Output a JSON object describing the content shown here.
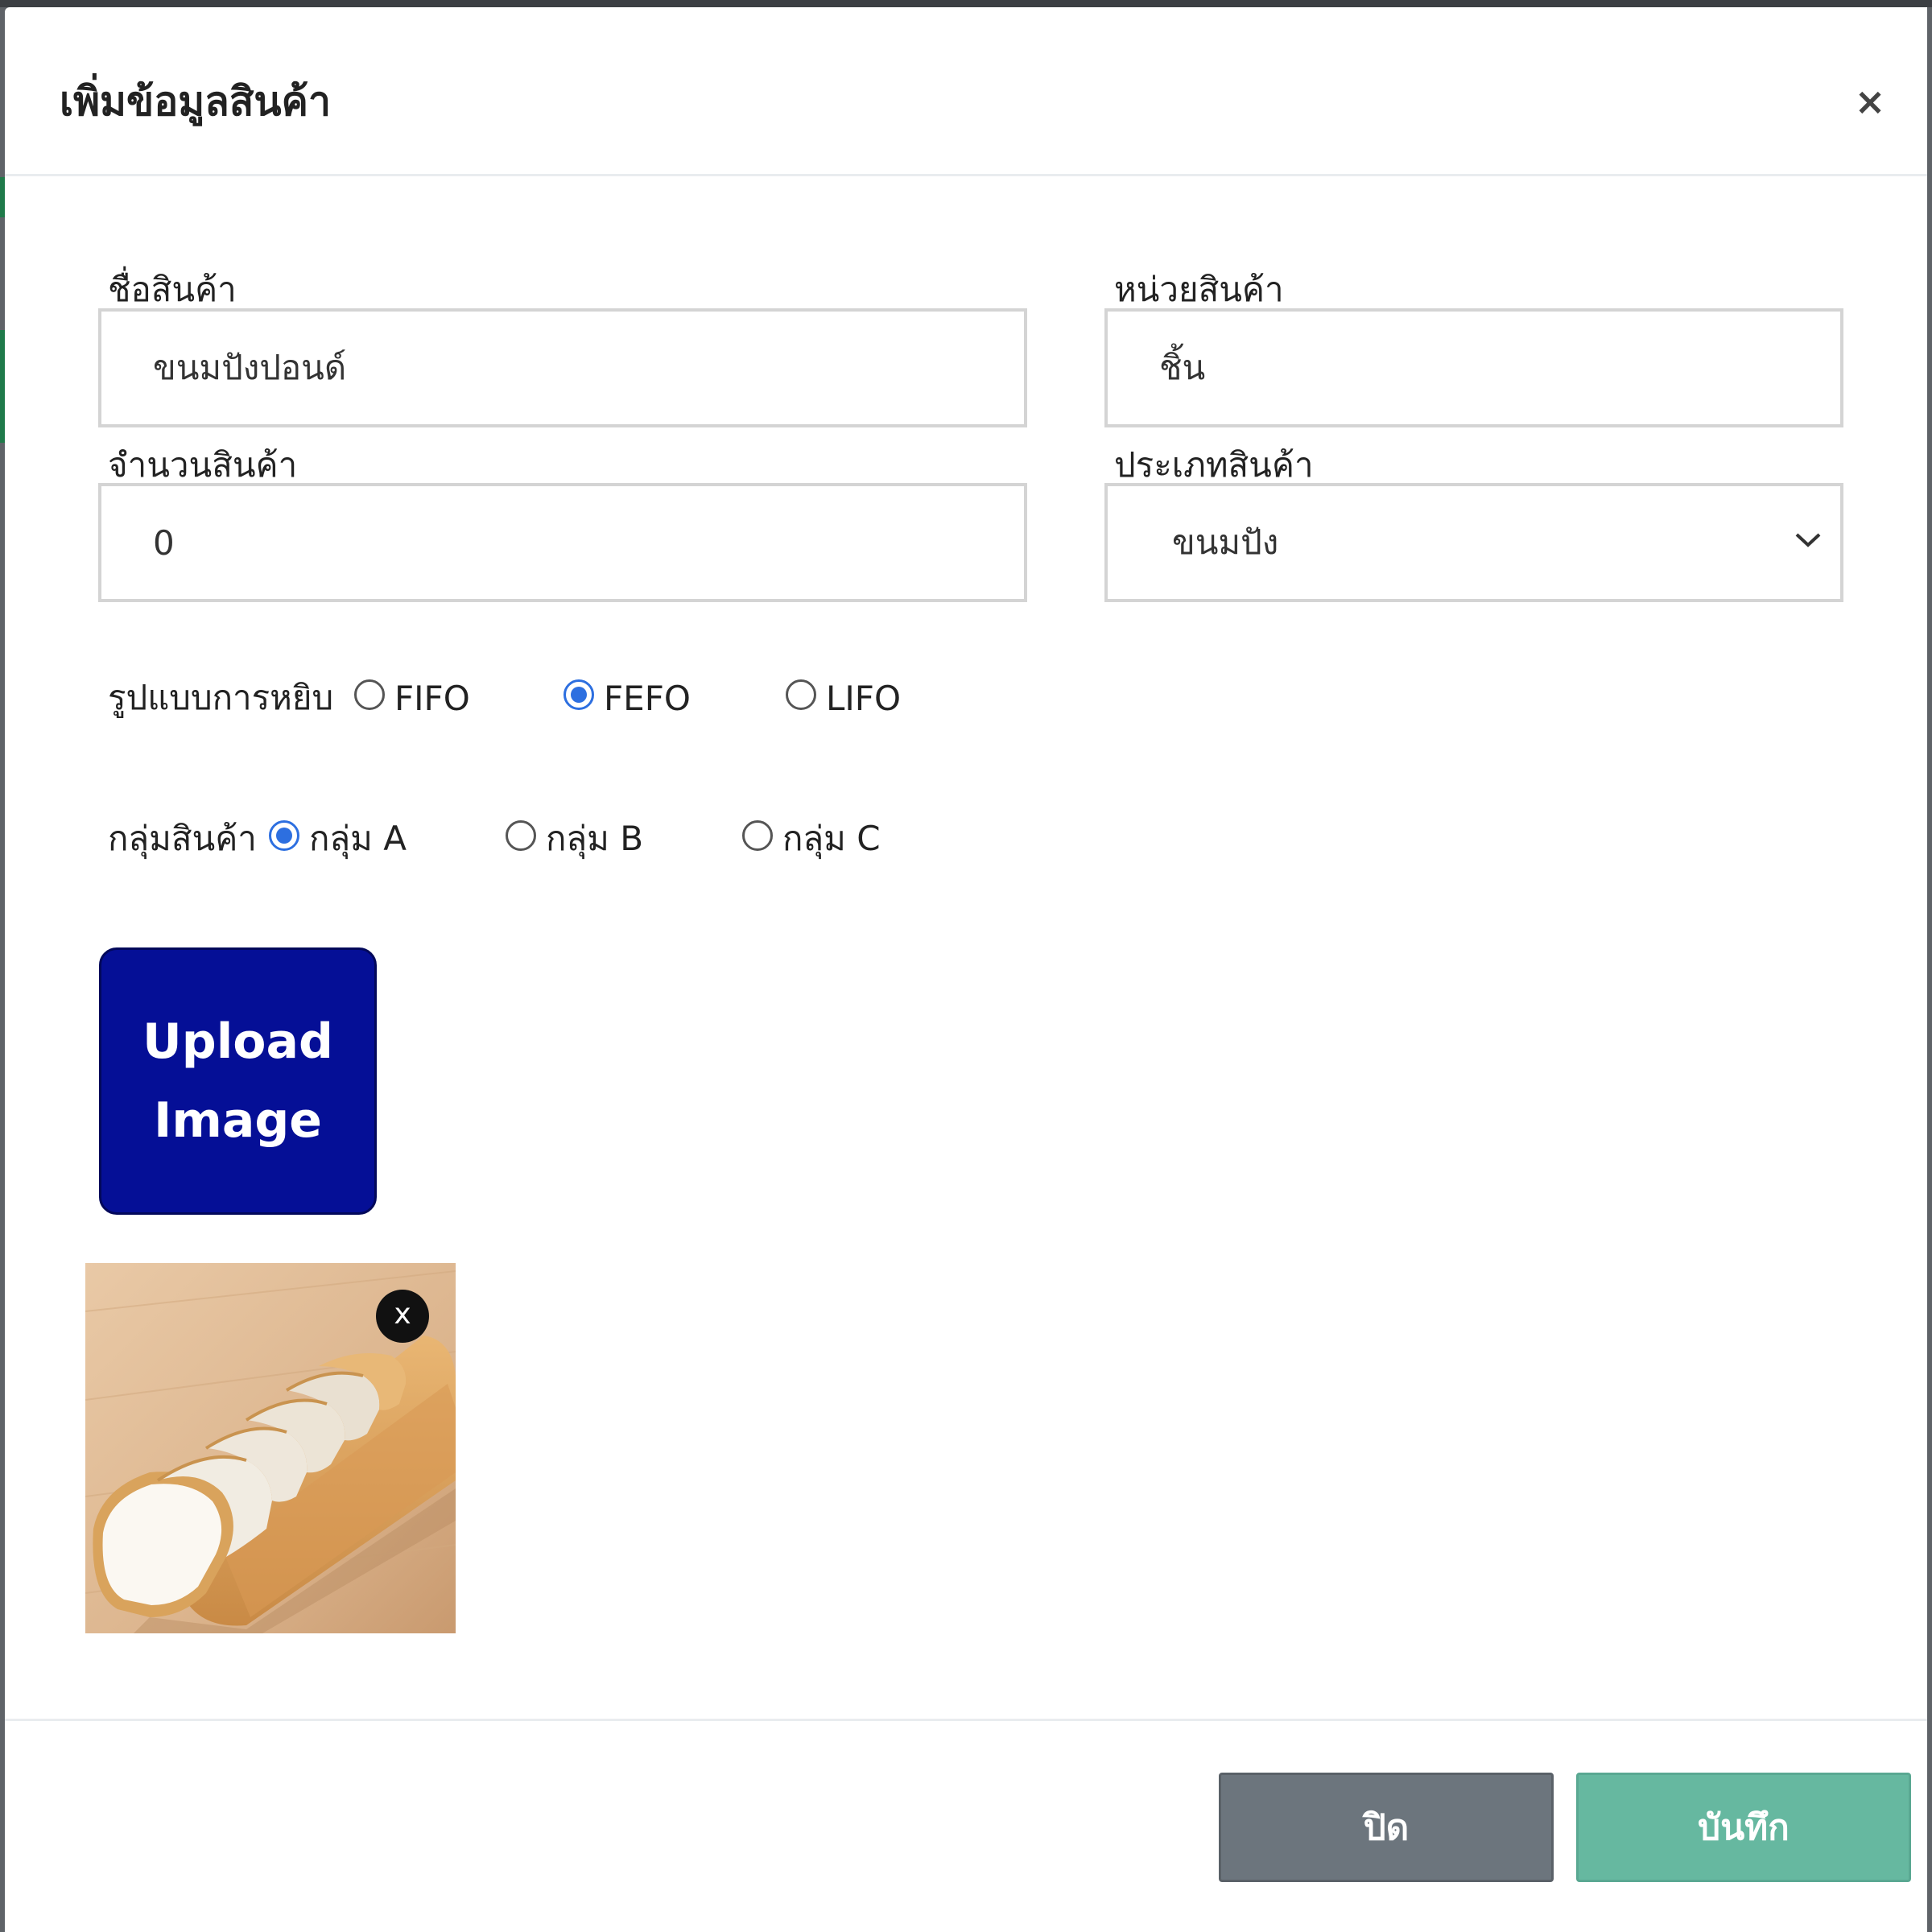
{
  "modal": {
    "title": "เพิ่มข้อมูลสินค้า",
    "close_symbol": "×"
  },
  "form": {
    "product_name": {
      "label": "ชื่อสินค้า",
      "value": "ขนมปังปอนด์"
    },
    "product_unit": {
      "label": "หน่วยสินค้า",
      "value": "ชิ้น"
    },
    "product_quantity": {
      "label": "จำนวนสินค้า",
      "value": "0"
    },
    "product_type": {
      "label": "ประเภทสินค้า",
      "selected": "ขนมปัง"
    },
    "picking_method": {
      "label": "รูปแบบการหยิบ",
      "options": [
        "FIFO",
        "FEFO",
        "LIFO"
      ],
      "selected": "FEFO"
    },
    "product_group": {
      "label": "กลุ่มสินค้า",
      "options": [
        "กลุ่ม A",
        "กลุ่ม B",
        "กลุ่ม C"
      ],
      "selected": "กลุ่ม A"
    }
  },
  "upload": {
    "line1": "Upload",
    "line2": "Image"
  },
  "preview": {
    "remove_symbol": "x",
    "image_subject": "sliced white bread loaf on wooden table"
  },
  "footer": {
    "close_label": "ปิด",
    "save_label": "บันทึก"
  },
  "colors": {
    "upload_button": "#050f96",
    "close_button": "#6c757d",
    "save_button": "#66b8a0",
    "radio_checked": "#2d6fe0"
  }
}
